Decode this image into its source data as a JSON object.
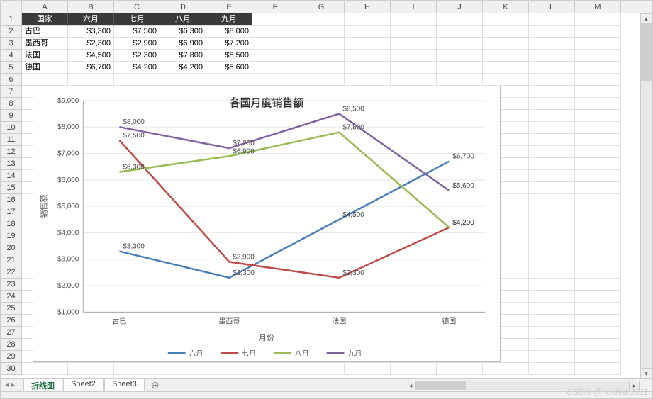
{
  "columns": [
    "A",
    "B",
    "C",
    "D",
    "E",
    "F",
    "G",
    "H",
    "I",
    "J",
    "K",
    "L",
    "M"
  ],
  "row_count": 30,
  "table": {
    "headers": [
      "国家",
      "六月",
      "七月",
      "八月",
      "九月"
    ],
    "rows": [
      {
        "label": "古巴",
        "vals": [
          "$3,300",
          "$7,500",
          "$6,300",
          "$8,000"
        ]
      },
      {
        "label": "墨西哥",
        "vals": [
          "$2,300",
          "$2,900",
          "$6,900",
          "$7,200"
        ]
      },
      {
        "label": "法国",
        "vals": [
          "$4,500",
          "$2,300",
          "$7,800",
          "$8,500"
        ]
      },
      {
        "label": "德国",
        "vals": [
          "$6,700",
          "$4,200",
          "$4,200",
          "$5,600"
        ]
      }
    ]
  },
  "chart_data": {
    "type": "line",
    "title": "各国月度销售额",
    "xlabel": "月份",
    "ylabel": "销售额",
    "categories": [
      "古巴",
      "墨西哥",
      "法国",
      "德国"
    ],
    "series": [
      {
        "name": "六月",
        "color": "#4a7ebb",
        "values": [
          3300,
          2300,
          4500,
          6700
        ]
      },
      {
        "name": "七月",
        "color": "#be4b48",
        "values": [
          7500,
          2900,
          2300,
          4200
        ]
      },
      {
        "name": "八月",
        "color": "#98b954",
        "values": [
          6300,
          6900,
          7800,
          4200
        ]
      },
      {
        "name": "九月",
        "color": "#8064a2",
        "values": [
          8000,
          7200,
          8500,
          5600
        ]
      }
    ],
    "ylim": [
      1000,
      9000
    ],
    "ytick": 1000
  },
  "sheets": {
    "tabs": [
      "折线图",
      "Sheet2",
      "Sheet3"
    ],
    "active": 0,
    "add_icon": "⊕"
  },
  "watermark": "CSDN @nuclear2011"
}
